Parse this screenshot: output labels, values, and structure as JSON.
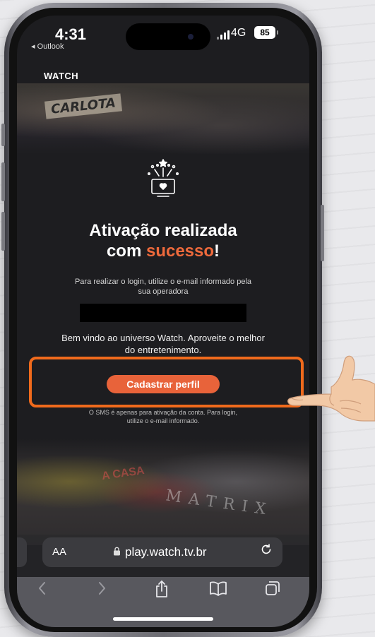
{
  "status_bar": {
    "time": "4:31",
    "back_app": "◂ Outlook",
    "network": "4G",
    "battery": "85"
  },
  "page": {
    "brand": "WATCH",
    "poster_text": "CARLOTA",
    "title_line1": "Ativação realizada",
    "title_line2_prefix": "com ",
    "title_highlight": "sucesso",
    "title_suffix": "!",
    "subtitle": "Para realizar o login, utilize o e-mail informado pela sua operadora",
    "welcome": "Bem vindo ao universo Watch. Aproveite o melhor do entretenimento.",
    "cta_label": "Cadastrar perfil",
    "note": "O SMS é apenas para ativação da conta. Para login, utilize o e-mail informado.",
    "poster_text_bottom": "MATRIX",
    "poster_text_bottom2": "A CASA"
  },
  "browser": {
    "text_size_label": "AA",
    "url": "play.watch.tv.br"
  },
  "icons": {
    "back": "chevron-left",
    "forward": "chevron-right",
    "share": "share",
    "bookmarks": "book",
    "tabs": "tabs",
    "reload": "reload",
    "lock": "lock"
  },
  "colors": {
    "accent": "#e8633a",
    "highlight_border": "#f06a1c",
    "page_background": "#1d1d20"
  }
}
